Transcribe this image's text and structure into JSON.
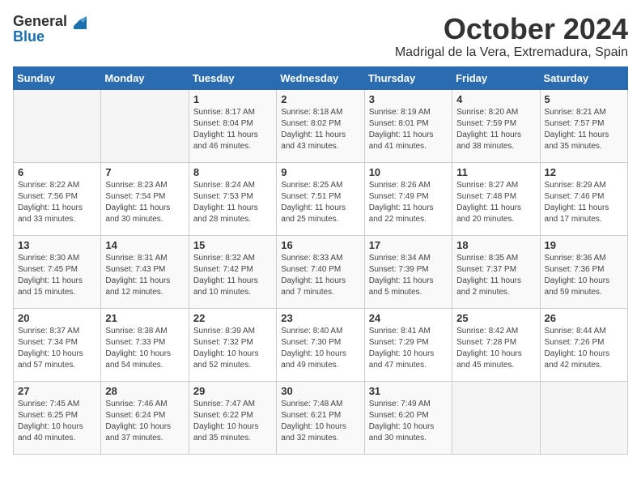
{
  "logo": {
    "general": "General",
    "blue": "Blue"
  },
  "title": "October 2024",
  "location": "Madrigal de la Vera, Extremadura, Spain",
  "weekdays": [
    "Sunday",
    "Monday",
    "Tuesday",
    "Wednesday",
    "Thursday",
    "Friday",
    "Saturday"
  ],
  "weeks": [
    [
      {
        "day": "",
        "info": ""
      },
      {
        "day": "",
        "info": ""
      },
      {
        "day": "1",
        "sunrise": "Sunrise: 8:17 AM",
        "sunset": "Sunset: 8:04 PM",
        "daylight": "Daylight: 11 hours and 46 minutes."
      },
      {
        "day": "2",
        "sunrise": "Sunrise: 8:18 AM",
        "sunset": "Sunset: 8:02 PM",
        "daylight": "Daylight: 11 hours and 43 minutes."
      },
      {
        "day": "3",
        "sunrise": "Sunrise: 8:19 AM",
        "sunset": "Sunset: 8:01 PM",
        "daylight": "Daylight: 11 hours and 41 minutes."
      },
      {
        "day": "4",
        "sunrise": "Sunrise: 8:20 AM",
        "sunset": "Sunset: 7:59 PM",
        "daylight": "Daylight: 11 hours and 38 minutes."
      },
      {
        "day": "5",
        "sunrise": "Sunrise: 8:21 AM",
        "sunset": "Sunset: 7:57 PM",
        "daylight": "Daylight: 11 hours and 35 minutes."
      }
    ],
    [
      {
        "day": "6",
        "sunrise": "Sunrise: 8:22 AM",
        "sunset": "Sunset: 7:56 PM",
        "daylight": "Daylight: 11 hours and 33 minutes."
      },
      {
        "day": "7",
        "sunrise": "Sunrise: 8:23 AM",
        "sunset": "Sunset: 7:54 PM",
        "daylight": "Daylight: 11 hours and 30 minutes."
      },
      {
        "day": "8",
        "sunrise": "Sunrise: 8:24 AM",
        "sunset": "Sunset: 7:53 PM",
        "daylight": "Daylight: 11 hours and 28 minutes."
      },
      {
        "day": "9",
        "sunrise": "Sunrise: 8:25 AM",
        "sunset": "Sunset: 7:51 PM",
        "daylight": "Daylight: 11 hours and 25 minutes."
      },
      {
        "day": "10",
        "sunrise": "Sunrise: 8:26 AM",
        "sunset": "Sunset: 7:49 PM",
        "daylight": "Daylight: 11 hours and 22 minutes."
      },
      {
        "day": "11",
        "sunrise": "Sunrise: 8:27 AM",
        "sunset": "Sunset: 7:48 PM",
        "daylight": "Daylight: 11 hours and 20 minutes."
      },
      {
        "day": "12",
        "sunrise": "Sunrise: 8:29 AM",
        "sunset": "Sunset: 7:46 PM",
        "daylight": "Daylight: 11 hours and 17 minutes."
      }
    ],
    [
      {
        "day": "13",
        "sunrise": "Sunrise: 8:30 AM",
        "sunset": "Sunset: 7:45 PM",
        "daylight": "Daylight: 11 hours and 15 minutes."
      },
      {
        "day": "14",
        "sunrise": "Sunrise: 8:31 AM",
        "sunset": "Sunset: 7:43 PM",
        "daylight": "Daylight: 11 hours and 12 minutes."
      },
      {
        "day": "15",
        "sunrise": "Sunrise: 8:32 AM",
        "sunset": "Sunset: 7:42 PM",
        "daylight": "Daylight: 11 hours and 10 minutes."
      },
      {
        "day": "16",
        "sunrise": "Sunrise: 8:33 AM",
        "sunset": "Sunset: 7:40 PM",
        "daylight": "Daylight: 11 hours and 7 minutes."
      },
      {
        "day": "17",
        "sunrise": "Sunrise: 8:34 AM",
        "sunset": "Sunset: 7:39 PM",
        "daylight": "Daylight: 11 hours and 5 minutes."
      },
      {
        "day": "18",
        "sunrise": "Sunrise: 8:35 AM",
        "sunset": "Sunset: 7:37 PM",
        "daylight": "Daylight: 11 hours and 2 minutes."
      },
      {
        "day": "19",
        "sunrise": "Sunrise: 8:36 AM",
        "sunset": "Sunset: 7:36 PM",
        "daylight": "Daylight: 10 hours and 59 minutes."
      }
    ],
    [
      {
        "day": "20",
        "sunrise": "Sunrise: 8:37 AM",
        "sunset": "Sunset: 7:34 PM",
        "daylight": "Daylight: 10 hours and 57 minutes."
      },
      {
        "day": "21",
        "sunrise": "Sunrise: 8:38 AM",
        "sunset": "Sunset: 7:33 PM",
        "daylight": "Daylight: 10 hours and 54 minutes."
      },
      {
        "day": "22",
        "sunrise": "Sunrise: 8:39 AM",
        "sunset": "Sunset: 7:32 PM",
        "daylight": "Daylight: 10 hours and 52 minutes."
      },
      {
        "day": "23",
        "sunrise": "Sunrise: 8:40 AM",
        "sunset": "Sunset: 7:30 PM",
        "daylight": "Daylight: 10 hours and 49 minutes."
      },
      {
        "day": "24",
        "sunrise": "Sunrise: 8:41 AM",
        "sunset": "Sunset: 7:29 PM",
        "daylight": "Daylight: 10 hours and 47 minutes."
      },
      {
        "day": "25",
        "sunrise": "Sunrise: 8:42 AM",
        "sunset": "Sunset: 7:28 PM",
        "daylight": "Daylight: 10 hours and 45 minutes."
      },
      {
        "day": "26",
        "sunrise": "Sunrise: 8:44 AM",
        "sunset": "Sunset: 7:26 PM",
        "daylight": "Daylight: 10 hours and 42 minutes."
      }
    ],
    [
      {
        "day": "27",
        "sunrise": "Sunrise: 7:45 AM",
        "sunset": "Sunset: 6:25 PM",
        "daylight": "Daylight: 10 hours and 40 minutes."
      },
      {
        "day": "28",
        "sunrise": "Sunrise: 7:46 AM",
        "sunset": "Sunset: 6:24 PM",
        "daylight": "Daylight: 10 hours and 37 minutes."
      },
      {
        "day": "29",
        "sunrise": "Sunrise: 7:47 AM",
        "sunset": "Sunset: 6:22 PM",
        "daylight": "Daylight: 10 hours and 35 minutes."
      },
      {
        "day": "30",
        "sunrise": "Sunrise: 7:48 AM",
        "sunset": "Sunset: 6:21 PM",
        "daylight": "Daylight: 10 hours and 32 minutes."
      },
      {
        "day": "31",
        "sunrise": "Sunrise: 7:49 AM",
        "sunset": "Sunset: 6:20 PM",
        "daylight": "Daylight: 10 hours and 30 minutes."
      },
      {
        "day": "",
        "info": ""
      },
      {
        "day": "",
        "info": ""
      }
    ]
  ]
}
